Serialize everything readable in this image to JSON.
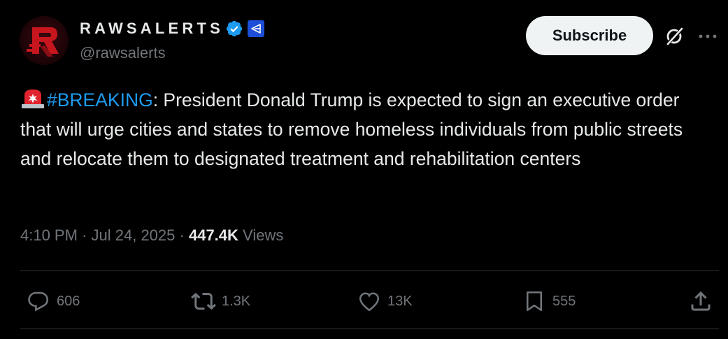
{
  "author": {
    "display_name": "RAWSALERTS",
    "handle": "@rawsalerts",
    "avatar_icon": "rawsalerts-logo",
    "verified_icon": "verified-badge-icon",
    "affiliate_icon": "affiliate-badge-icon"
  },
  "header": {
    "subscribe_label": "Subscribe",
    "grok_icon": "grok-icon",
    "more_icon": "more-icon"
  },
  "post": {
    "emoji": "police-siren-icon",
    "hashtag": "#BREAKING",
    "text": ": President Donald Trump is expected to sign an executive order that will urge cities and states to remove homeless individuals from public streets and relocate them to designated treatment and rehabilitation centers"
  },
  "meta": {
    "time": "4:10 PM",
    "separator": "·",
    "date": "Jul 24, 2025",
    "views_count": "447.4K",
    "views_label": "Views"
  },
  "actions": {
    "replies": "606",
    "reposts": "1.3K",
    "likes": "13K",
    "bookmarks": "555"
  },
  "colors": {
    "background": "#000000",
    "text": "#e7e9ea",
    "muted": "#71767b",
    "link": "#1d9bf0",
    "verified": "#1d9bf0",
    "divider": "#2f3336"
  }
}
